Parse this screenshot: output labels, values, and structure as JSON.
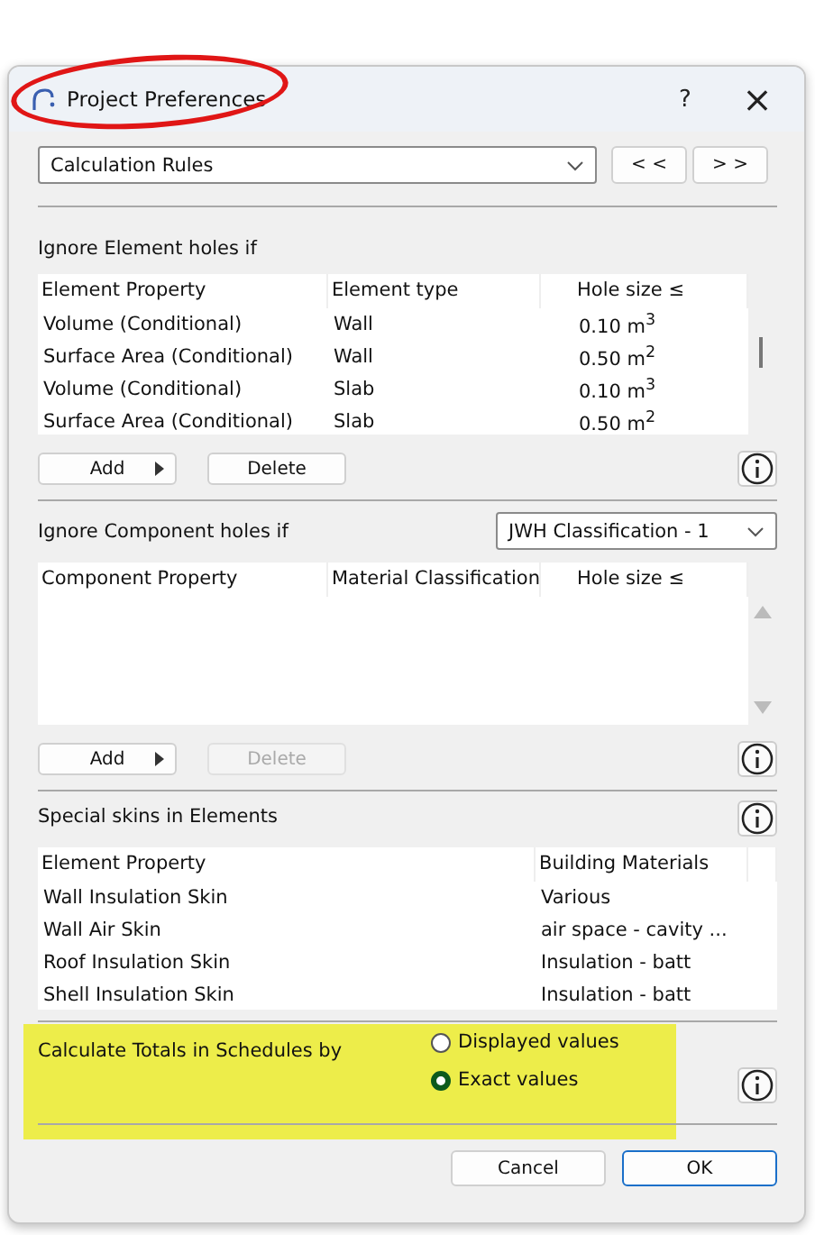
{
  "window": {
    "title": "Project Preferences",
    "help": "?",
    "close": "×"
  },
  "page_selector": {
    "value": "Calculation Rules",
    "prev": "< <",
    "next": "> >"
  },
  "element_holes": {
    "label": "Ignore Element holes if",
    "columns": [
      "Element Property",
      "Element type",
      "Hole size ≤"
    ],
    "rows": [
      [
        "Volume (Conditional)",
        "Wall",
        "0.10 m$^{3}$"
      ],
      [
        "Surface Area (Conditional)",
        "Wall",
        "0.50 m$^{2}$"
      ],
      [
        "Volume (Conditional)",
        "Slab",
        "0.10 m$^{3}$"
      ],
      [
        "Surface Area (Conditional)",
        "Slab",
        "0.50 m$^{2}$"
      ]
    ],
    "buttons": [
      {
        "label": "Add",
        "disabled": false
      },
      {
        "label": "Delete",
        "disabled": false
      }
    ]
  },
  "component_holes": {
    "label": "Ignore Component holes if",
    "classification": "JWH Classification - 1",
    "columns": [
      "Component Property",
      "Material Classification",
      "Hole size ≤"
    ],
    "buttons": [
      {
        "label": "Add",
        "disabled": false
      },
      {
        "label": "Delete",
        "disabled": true
      }
    ]
  },
  "special_skins": {
    "label": "Special skins in Elements",
    "columns": [
      "Element Property",
      "Building Materials"
    ],
    "rows": [
      [
        "Wall Insulation Skin",
        "Various"
      ],
      [
        "Wall Air Skin",
        "air space - cavity ..."
      ],
      [
        "Roof Insulation Skin",
        "Insulation - batt"
      ],
      [
        "Shell Insulation Skin",
        "Insulation - batt"
      ]
    ]
  },
  "totals": {
    "label": "Calculate Totals in Schedules by",
    "options": [
      {
        "label": "Displayed values",
        "selected": false
      },
      {
        "label": "Exact values",
        "selected": true
      }
    ]
  },
  "buttons": [
    {
      "label": "Cancel",
      "default": false
    },
    {
      "label": "OK",
      "default": true
    }
  ]
}
